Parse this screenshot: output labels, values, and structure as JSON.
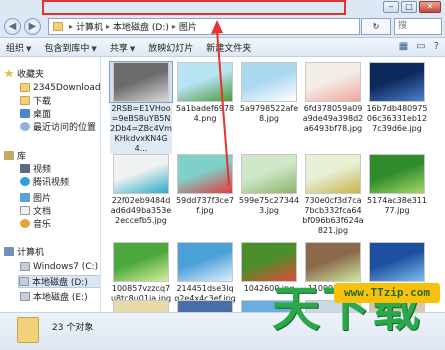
{
  "window": {
    "buttons": {
      "minimize": "‒",
      "maximize": "□",
      "close": "✕"
    }
  },
  "address": {
    "back": "◀",
    "forward": "▶",
    "crumbs": [
      "计算机",
      "本地磁盘 (D:)",
      "图片"
    ],
    "refresh": "↻",
    "search_placeholder": "搜"
  },
  "toolbar": {
    "organize": "组织",
    "include": "包含到库中",
    "share": "共享",
    "slideshow": "放映幻灯片",
    "new_folder": "新建文件夹"
  },
  "sidebar": {
    "items": [
      {
        "label": "收藏夹",
        "icon": "star-icon"
      },
      {
        "label": "2345Downloads",
        "icon": "folder-icon"
      },
      {
        "label": "下载",
        "icon": "folder-icon"
      },
      {
        "label": "桌面",
        "icon": "desktop-icon"
      },
      {
        "label": "最近访问的位置",
        "icon": "recent-icon"
      },
      {
        "label": "库",
        "icon": "library-icon"
      },
      {
        "label": "视频",
        "icon": "video-icon"
      },
      {
        "label": "腾讯视频",
        "icon": "video-icon"
      },
      {
        "label": "图片",
        "icon": "picture-icon"
      },
      {
        "label": "文档",
        "icon": "document-icon"
      },
      {
        "label": "音乐",
        "icon": "music-icon"
      },
      {
        "label": "计算机",
        "icon": "computer-icon"
      },
      {
        "label": "Windows7 (C:)",
        "icon": "drive-icon"
      },
      {
        "label": "本地磁盘 (D:)",
        "icon": "drive-icon"
      },
      {
        "label": "本地磁盘 (E:)",
        "icon": "drive-icon"
      }
    ]
  },
  "files": [
    {
      "name": "2RSB=E1VHoo=9eBS8uYB5N2Db4=ZBc4VmKHkdvxKN4G4...",
      "colors": [
        "#6b6b6b",
        "#d9d9d9"
      ]
    },
    {
      "name": "5a1badef69784.png",
      "colors": [
        "#b7e3f3",
        "#4f9a3a"
      ]
    },
    {
      "name": "5a9798522afe8.jpg",
      "colors": [
        "#a9d8f0",
        "#ffffff"
      ]
    },
    {
      "name": "6fd378059a09a9de49a398d2a6493bf78.jpg",
      "colors": [
        "#f4ede6",
        "#f0a6a0"
      ]
    },
    {
      "name": "16b7db48097506c36331eb127c39d6e.jpg",
      "colors": [
        "#0d2a5c",
        "#4f7fd1"
      ]
    },
    {
      "name": "22f02eb9484dad6d49ba353e2eccefb5.jpg",
      "colors": [
        "#f0f2f2",
        "#2da8c6"
      ]
    },
    {
      "name": "59dd737f3ce7f.jpg",
      "colors": [
        "#7fd0c9",
        "#e33a3a"
      ]
    },
    {
      "name": "599e75c273443.jpg",
      "colors": [
        "#cfe8c9",
        "#8ab46c"
      ]
    },
    {
      "name": "730e0cf3d7ca7bcb332fca64bf096b63f624a821.jpg",
      "colors": [
        "#e7f0d5",
        "#c8b24a"
      ]
    },
    {
      "name": "5174ac38e31177.jpg",
      "colors": [
        "#2f8c2a",
        "#a6d66a"
      ]
    },
    {
      "name": "100857vzzcq7u8tc8u01ia.jpg",
      "colors": [
        "#4aa83c",
        "#d7ee9c"
      ]
    },
    {
      "name": "214451dse3lqq2e4x4c3ef.jpg",
      "colors": [
        "#4ba0d8",
        "#dfeffa"
      ]
    },
    {
      "name": "1042600.jpg",
      "colors": [
        "#4a8f2a",
        "#e04a3a"
      ]
    },
    {
      "name": "1100956.jpg",
      "colors": [
        "#8a6a4a",
        "#cfe8a3"
      ]
    },
    {
      "name": "1114225.jpg",
      "colors": [
        "#1e4fa0",
        "#79c0ef"
      ]
    },
    {
      "name": "",
      "colors": [
        "#e8d9a8",
        "#f5efe0"
      ]
    },
    {
      "name": "",
      "colors": [
        "#4a6fa8",
        "#2a3f66"
      ]
    },
    {
      "name": "",
      "colors": [
        "#6aaee0",
        "#d0e8f7"
      ]
    },
    {
      "name": "",
      "colors": [
        "#cbd6e6",
        "#95a8c7"
      ]
    },
    {
      "name": "",
      "colors": [
        "#d9c8a6",
        "#f2ead8"
      ]
    }
  ],
  "status": {
    "count": "23 个对象"
  },
  "watermark": {
    "url": "www.TTzip.com",
    "brand": "天下载"
  }
}
